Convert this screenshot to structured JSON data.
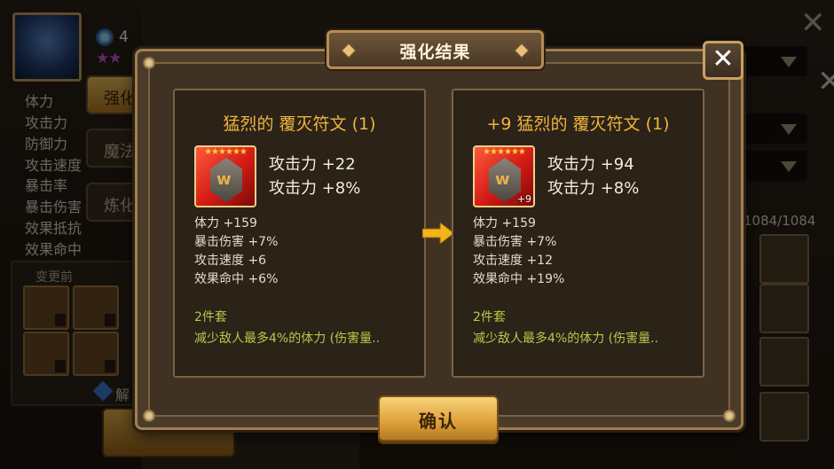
{
  "background": {
    "player": {
      "level_text": "4",
      "stars": "★★"
    },
    "stats_labels_primary": [
      "体力",
      "攻击力",
      "防御力",
      "攻击速度"
    ],
    "stats_labels_secondary": [
      "暴击率",
      "暴击伤害",
      "效果抵抗",
      "效果命中"
    ],
    "side_tabs": [
      "强化",
      "魔法",
      "炼化"
    ],
    "before_label": "变更前",
    "decompose_label": "解",
    "rune_count": "1084/1084"
  },
  "dialog": {
    "title": "强化结果",
    "close_label": "✕",
    "confirm_label": "确认",
    "before": {
      "title": "猛烈的 覆灭符文 (1)",
      "stars": "★★★★★★",
      "level_badge": "",
      "main_stats": [
        "攻击力 +22",
        "攻击力 +8%"
      ],
      "sub_stats": [
        "体力 +159",
        "暴击伤害 +7%",
        "攻击速度 +6",
        "效果命中 +6%"
      ],
      "set_name": "2件套",
      "set_desc": "减少敌人最多4%的体力 (伤害量.."
    },
    "after": {
      "title": "+9 猛烈的 覆灭符文 (1)",
      "stars": "★★★★★★",
      "level_badge": "+9",
      "main_stats": [
        "攻击力 +94",
        "攻击力 +8%"
      ],
      "sub_stats": [
        "体力 +159",
        "暴击伤害 +7%",
        "攻击速度 +12",
        "效果命中 +19%"
      ],
      "set_name": "2件套",
      "set_desc": "减少敌人最多4%的体力 (伤害量.."
    }
  },
  "colors": {
    "title_gold": "#f0b43c",
    "set_green": "#b7c94a",
    "rune_red": "#d11a14"
  }
}
